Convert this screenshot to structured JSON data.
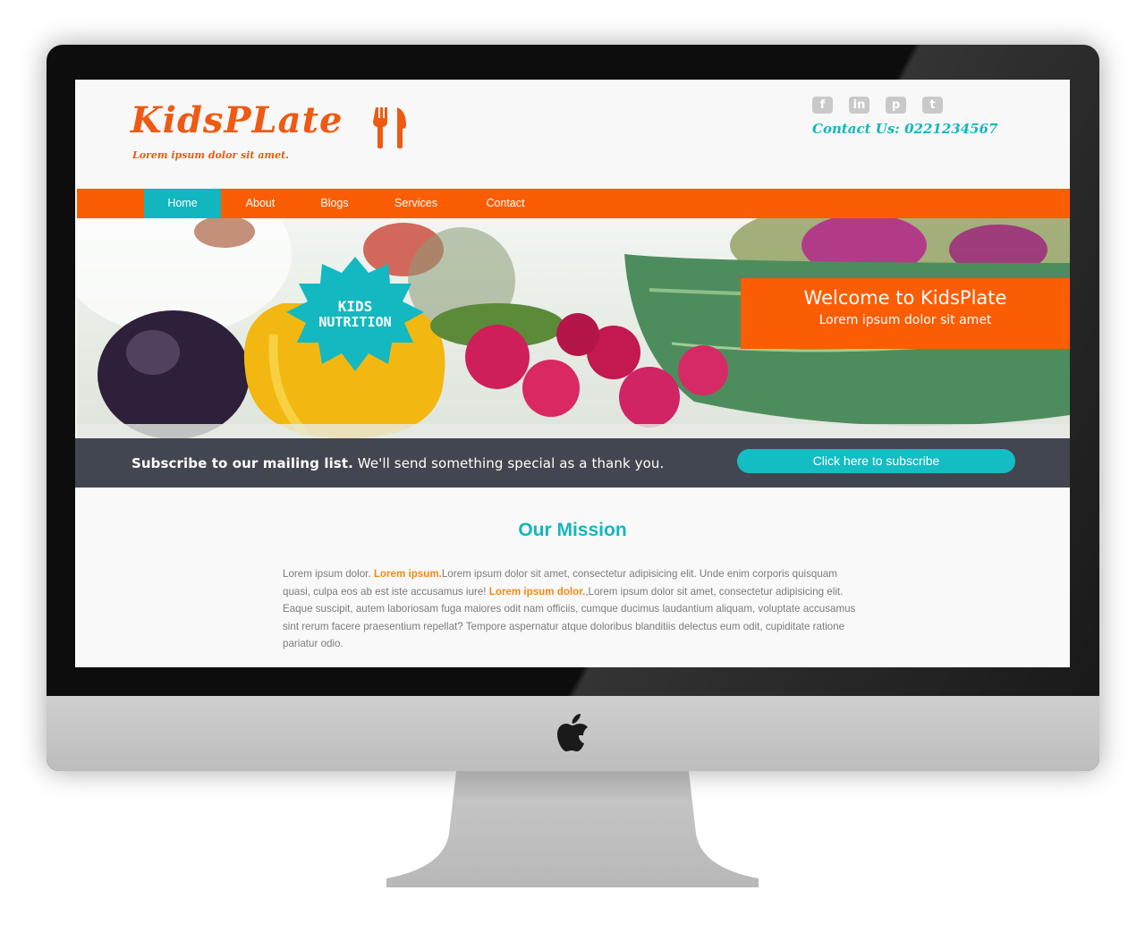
{
  "site": {
    "brand": "KidsPLate",
    "tagline": "Lorem ipsum dolor sit amet.",
    "contact": "Contact Us: 0221234567",
    "social_icons": [
      "facebook-icon",
      "linkedin-icon",
      "pinterest-icon",
      "twitter-icon"
    ],
    "colors": {
      "accent": "#fb5d05",
      "teal": "#13b7bd",
      "dark_bar": "#414650"
    }
  },
  "nav": {
    "items": [
      {
        "label": "Home"
      },
      {
        "label": "About"
      },
      {
        "label": "Blogs"
      },
      {
        "label": "Services"
      },
      {
        "label": "Contact"
      }
    ],
    "active": "Home"
  },
  "hero": {
    "badge_line1": "KIDS",
    "badge_line2": "NUTRITION",
    "welcome_title": "Welcome to KidsPlate",
    "welcome_sub": "Lorem ipsum dolor sit amet"
  },
  "subscribe": {
    "bold_text": "Subscribe to our mailing list.",
    "text": "We'll send something special as a thank you.",
    "button": "Click here to subscribe"
  },
  "mission": {
    "title": "Our Mission",
    "p1": "Lorem ipsum dolor.",
    "h1": "Lorem ipsum.",
    "p2": "Lorem ipsum dolor sit amet, consectetur adipisicing elit. Unde enim corporis quisquam quasi, culpa eos ab est iste accusamus iure!",
    "h2": "Lorem ipsum dolor.",
    "p3": ",Lorem ipsum dolor sit amet, consectetur adipisicing elit. Eaque suscipit, autem laboriosam fuga maiores odit nam officiis, cumque ducimus laudantium aliquam, voluptate accusamus sint rerum facere praesentium repellat? Tempore aspernatur atque doloribus blanditiis delectus eum odit, cupiditate ratione pariatur odio."
  }
}
